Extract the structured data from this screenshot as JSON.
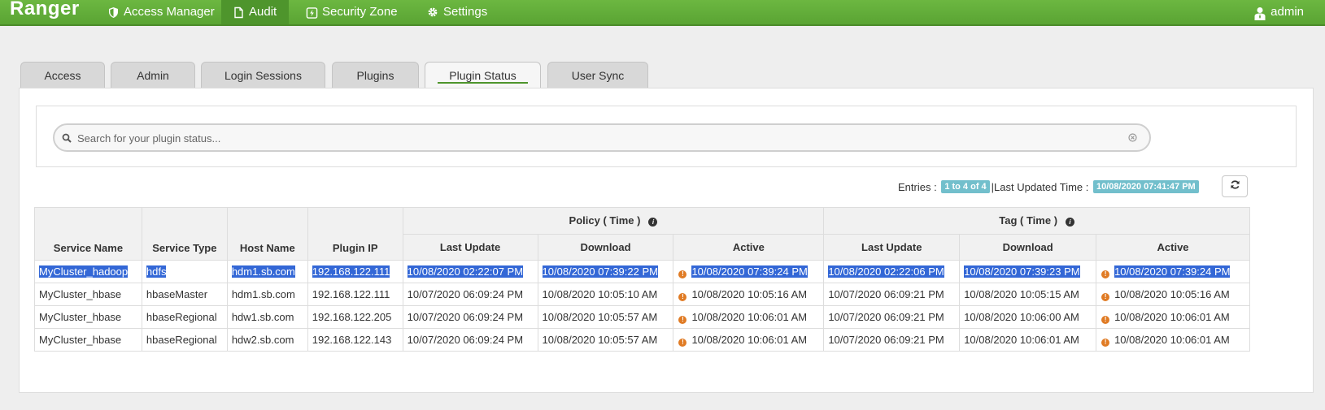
{
  "navbar": {
    "brand": "Ranger",
    "items": [
      {
        "label": "Access Manager",
        "icon": "shield-icon"
      },
      {
        "label": "Audit",
        "icon": "file-icon",
        "active": true
      },
      {
        "label": "Security Zone",
        "icon": "zone-icon"
      },
      {
        "label": "Settings",
        "icon": "gear-icon"
      }
    ],
    "user": "admin"
  },
  "tabs": [
    {
      "label": "Access"
    },
    {
      "label": "Admin"
    },
    {
      "label": "Login Sessions"
    },
    {
      "label": "Plugins"
    },
    {
      "label": "Plugin Status",
      "active": true
    },
    {
      "label": "User Sync"
    }
  ],
  "search": {
    "placeholder": "Search for your plugin status...",
    "value": ""
  },
  "status": {
    "entries_label": "Entries :",
    "entries_value": "1 to 4 of 4",
    "separator": "|",
    "last_updated_label": "Last Updated Time :",
    "last_updated_value": "10/08/2020 07:41:47 PM"
  },
  "table": {
    "group_headers": {
      "policy": "Policy ( Time )",
      "tag": "Tag ( Time )"
    },
    "columns": [
      "Service Name",
      "Service Type",
      "Host Name",
      "Plugin IP",
      "Last Update",
      "Download",
      "Active",
      "Last Update",
      "Download",
      "Active"
    ],
    "rows": [
      [
        "MyCluster_hadoop",
        "hdfs",
        "hdm1.sb.com",
        "192.168.122.111",
        "10/08/2020 02:22:07 PM",
        "10/08/2020 07:39:22 PM",
        "10/08/2020 07:39:24 PM",
        "10/08/2020 02:22:06 PM",
        "10/08/2020 07:39:23 PM",
        "10/08/2020 07:39:24 PM"
      ],
      [
        "MyCluster_hbase",
        "hbaseMaster",
        "hdm1.sb.com",
        "192.168.122.111",
        "10/07/2020 06:09:24 PM",
        "10/08/2020 10:05:10 AM",
        "10/08/2020 10:05:16 AM",
        "10/07/2020 06:09:21 PM",
        "10/08/2020 10:05:15 AM",
        "10/08/2020 10:05:16 AM"
      ],
      [
        "MyCluster_hbase",
        "hbaseRegional",
        "hdw1.sb.com",
        "192.168.122.205",
        "10/07/2020 06:09:24 PM",
        "10/08/2020 10:05:57 AM",
        "10/08/2020 10:06:01 AM",
        "10/07/2020 06:09:21 PM",
        "10/08/2020 10:06:00 AM",
        "10/08/2020 10:06:01 AM"
      ],
      [
        "MyCluster_hbase",
        "hbaseRegional",
        "hdw2.sb.com",
        "192.168.122.143",
        "10/07/2020 06:09:24 PM",
        "10/08/2020 10:05:57 AM",
        "10/08/2020 10:06:01 AM",
        "10/07/2020 06:09:21 PM",
        "10/08/2020 10:06:01 AM",
        "10/08/2020 10:06:01 AM"
      ]
    ]
  },
  "colors": {
    "navbar": "#5aa433",
    "accent": "#4e952c",
    "badge": "#72bfcc",
    "warning": "#e07b24",
    "selection": "#3367d6"
  }
}
